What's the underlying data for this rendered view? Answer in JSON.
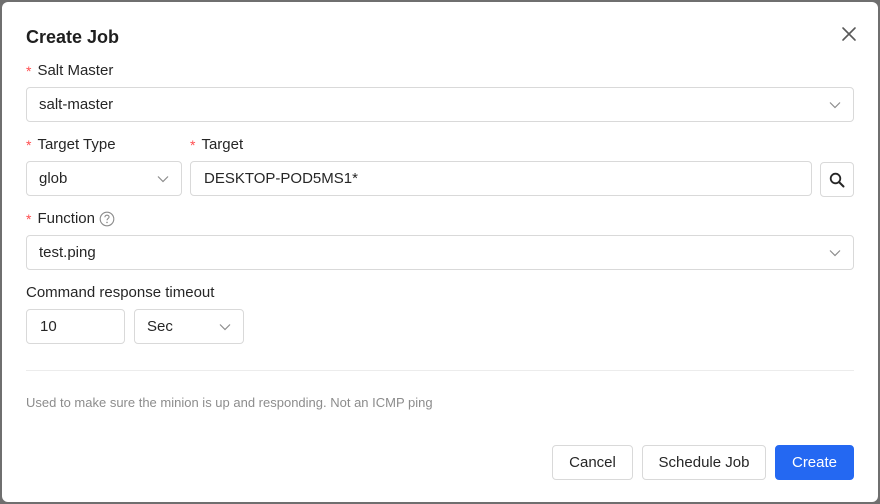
{
  "dialog": {
    "title": "Create Job"
  },
  "fields": {
    "salt_master": {
      "label": "Salt Master",
      "value": "salt-master"
    },
    "target_type": {
      "label": "Target Type",
      "value": "glob"
    },
    "target": {
      "label": "Target",
      "value": "DESKTOP-POD5MS1*"
    },
    "function": {
      "label": "Function",
      "value": "test.ping"
    },
    "timeout": {
      "label": "Command response timeout",
      "value": "10",
      "unit": "Sec"
    }
  },
  "required_mark": "*",
  "description": "Used to make sure the minion is up and responding. Not an ICMP ping",
  "buttons": {
    "cancel": "Cancel",
    "schedule": "Schedule Job",
    "create": "Create"
  },
  "colors": {
    "primary": "#2468f2",
    "required": "#ff4d4f",
    "border": "#d9d9d9"
  }
}
